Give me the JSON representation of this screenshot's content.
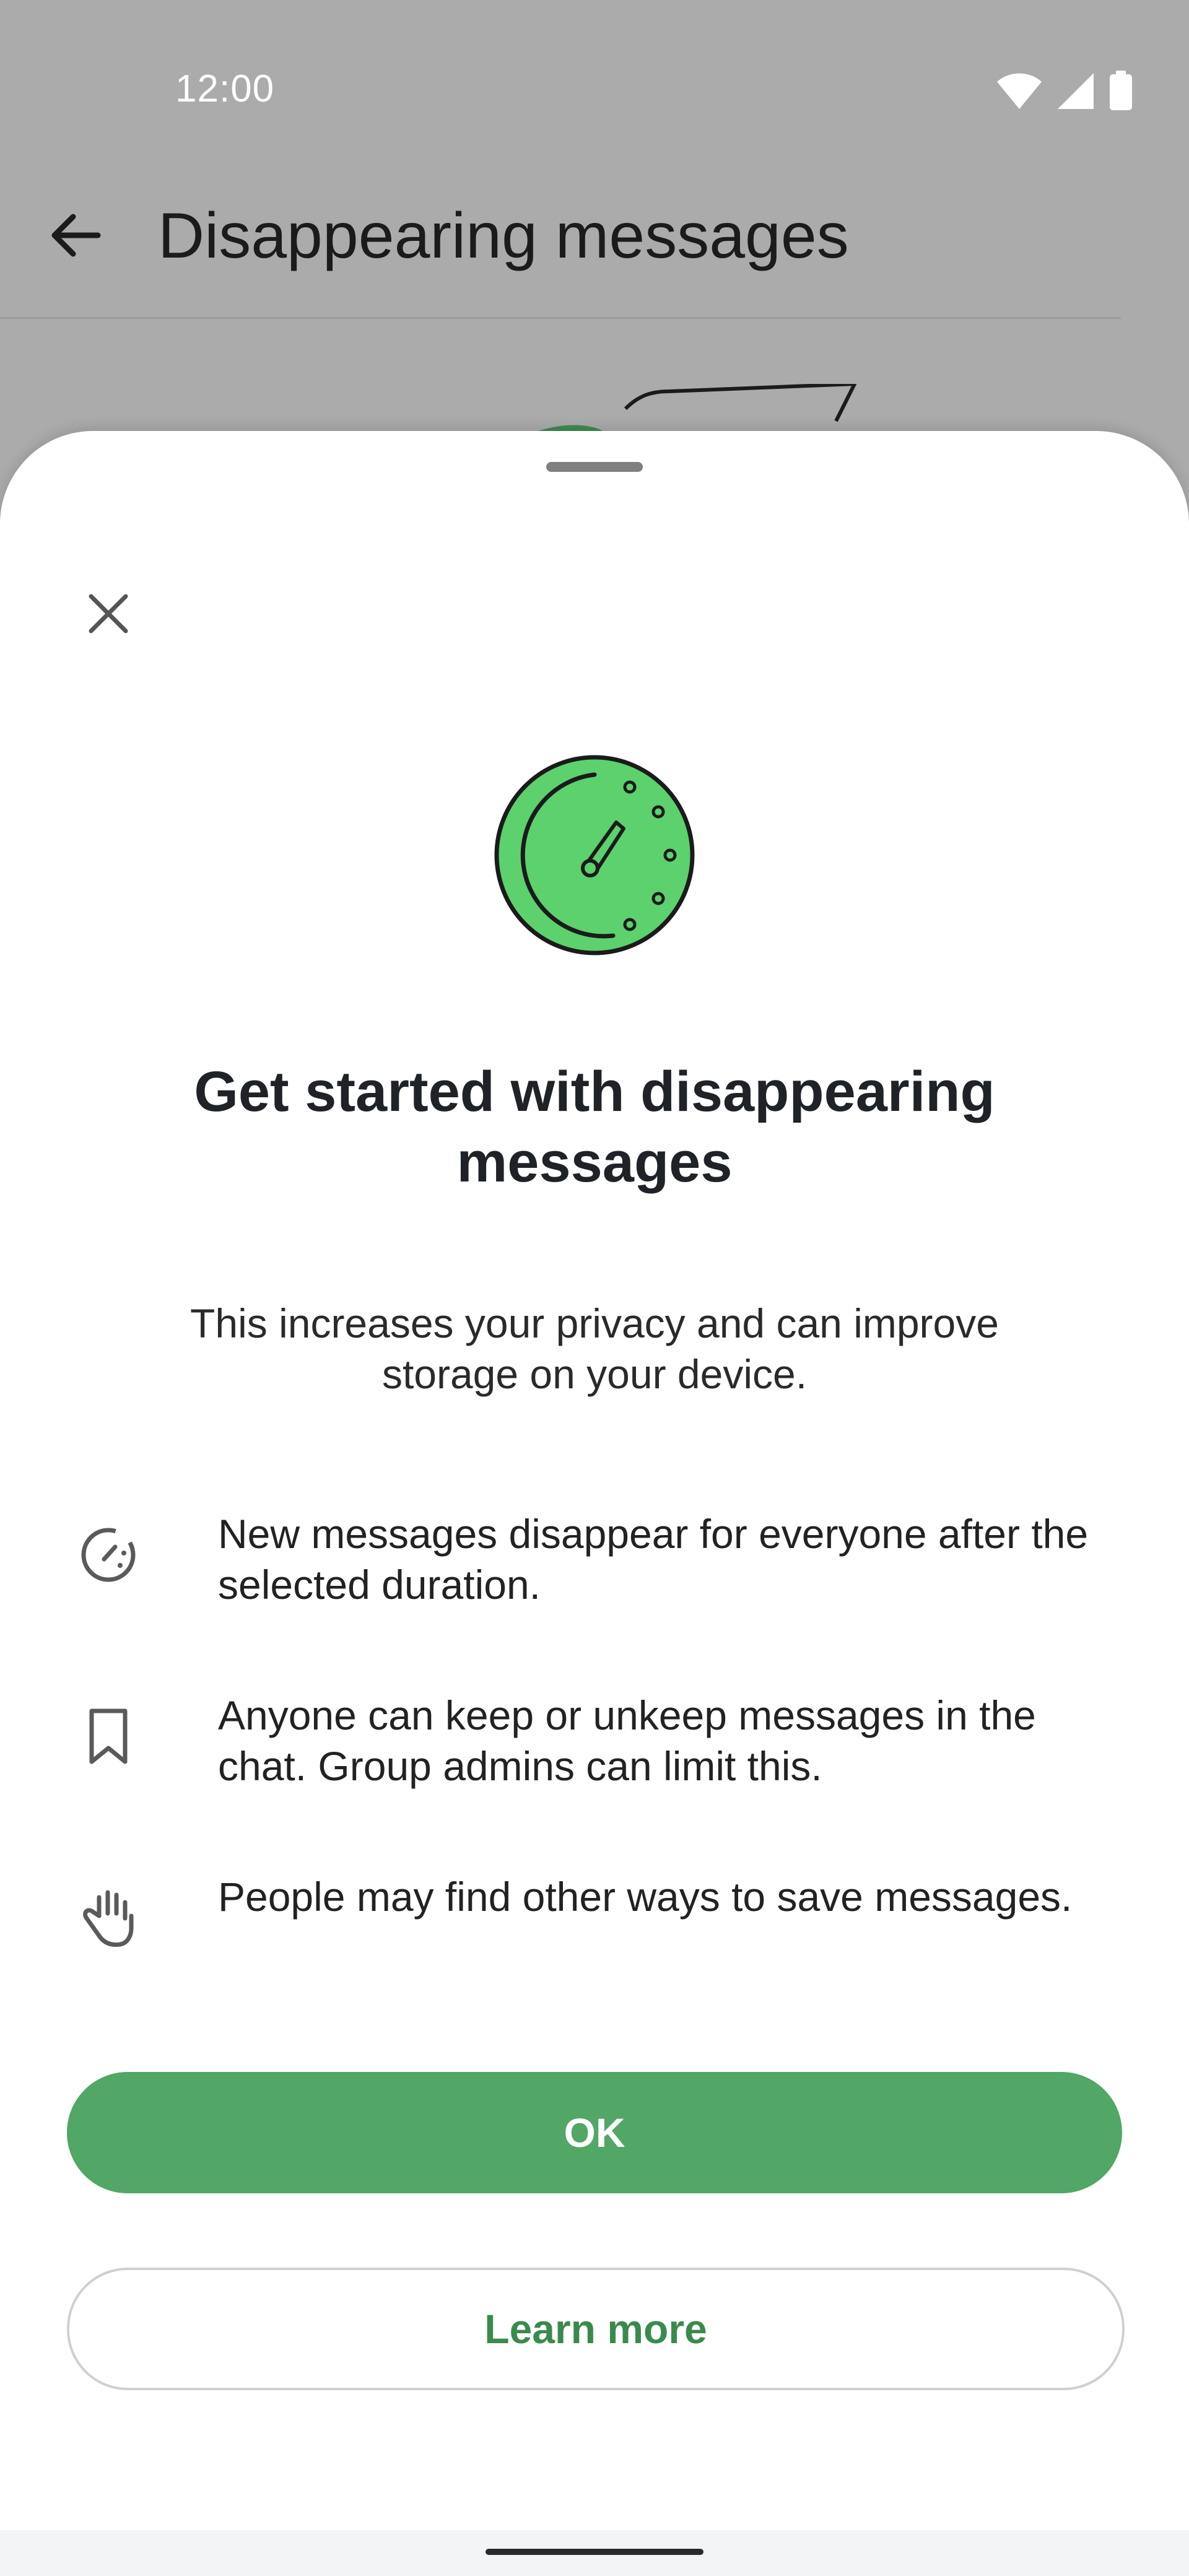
{
  "status_bar": {
    "time": "12:00",
    "icons": [
      "wifi-icon",
      "signal-icon",
      "battery-icon"
    ]
  },
  "app_bar": {
    "title": "Disappearing messages",
    "back_icon": "arrow-back-icon"
  },
  "sheet": {
    "close_icon": "close-icon",
    "hero_icon": "timer-icon",
    "title": "Get started with disappearing messages",
    "subtitle": "This increases your privacy and can improve storage on your device.",
    "features": [
      {
        "icon": "disappearing-timer-icon",
        "text": "New messages disappear for everyone after the selected duration."
      },
      {
        "icon": "bookmark-icon",
        "text": "Anyone can keep or unkeep messages in the chat. Group admins can limit this."
      },
      {
        "icon": "hand-icon",
        "text": "People may find other ways to save messages."
      }
    ],
    "ok_label": "OK",
    "learn_more_label": "Learn more"
  },
  "colors": {
    "accent": "#52a666",
    "accent_text": "#3b8a4d",
    "hero_fill": "#5cd16e",
    "scrim": "#ababab"
  }
}
